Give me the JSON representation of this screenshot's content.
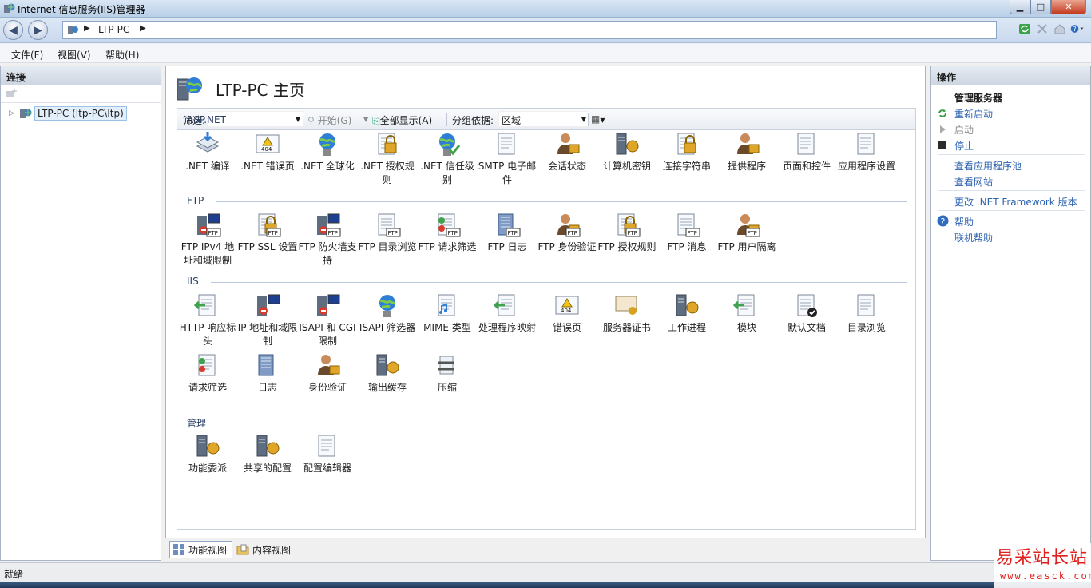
{
  "window": {
    "title": "Internet 信息服务(IIS)管理器"
  },
  "address": {
    "crumbs": [
      "LTP-PC"
    ]
  },
  "menu": {
    "items": [
      "文件(F)",
      "视图(V)",
      "帮助(H)"
    ]
  },
  "connections": {
    "title": "连接",
    "tree": [
      {
        "label": "LTP-PC (ltp-PC\\ltp)",
        "expanded": false,
        "selected": true
      }
    ]
  },
  "home": {
    "title": "LTP-PC 主页",
    "filter": {
      "label": "筛选:",
      "start": "开始(G)",
      "show_all": "全部显示(A)",
      "group_by_label": "分组依据:",
      "group_by_value": "区域"
    },
    "groups": [
      {
        "title": "ASP.NET",
        "features": [
          {
            "label": ".NET 编译",
            "icon": "net-compile-icon"
          },
          {
            "label": ".NET 错误页",
            "icon": "net-error-pages-icon"
          },
          {
            "label": ".NET 全球化",
            "icon": "net-globalization-icon"
          },
          {
            "label": ".NET 授权规则",
            "icon": "net-authorization-icon"
          },
          {
            "label": ".NET 信任级别",
            "icon": "net-trust-levels-icon"
          },
          {
            "label": "SMTP 电子邮件",
            "icon": "smtp-email-icon"
          },
          {
            "label": "会话状态",
            "icon": "session-state-icon"
          },
          {
            "label": "计算机密钥",
            "icon": "machine-key-icon"
          },
          {
            "label": "连接字符串",
            "icon": "connection-strings-icon"
          },
          {
            "label": "提供程序",
            "icon": "providers-icon"
          },
          {
            "label": "页面和控件",
            "icon": "pages-controls-icon"
          },
          {
            "label": "应用程序设置",
            "icon": "app-settings-icon"
          }
        ]
      },
      {
        "title": "FTP",
        "features": [
          {
            "label": "FTP IPv4 地址和域限制",
            "icon": "ftp-ip-restrictions-icon"
          },
          {
            "label": "FTP SSL 设置",
            "icon": "ftp-ssl-icon"
          },
          {
            "label": "FTP 防火墙支持",
            "icon": "ftp-firewall-icon"
          },
          {
            "label": "FTP 目录浏览",
            "icon": "ftp-directory-browsing-icon"
          },
          {
            "label": "FTP 请求筛选",
            "icon": "ftp-request-filtering-icon"
          },
          {
            "label": "FTP 日志",
            "icon": "ftp-logging-icon"
          },
          {
            "label": "FTP 身份验证",
            "icon": "ftp-authentication-icon"
          },
          {
            "label": "FTP 授权规则",
            "icon": "ftp-authorization-icon"
          },
          {
            "label": "FTP 消息",
            "icon": "ftp-messages-icon"
          },
          {
            "label": "FTP 用户隔离",
            "icon": "ftp-user-isolation-icon"
          }
        ]
      },
      {
        "title": "IIS",
        "features": [
          {
            "label": "HTTP 响应标头",
            "icon": "http-headers-icon"
          },
          {
            "label": "IP 地址和域限制",
            "icon": "ip-restrictions-icon"
          },
          {
            "label": "ISAPI 和 CGI 限制",
            "icon": "isapi-cgi-icon"
          },
          {
            "label": "ISAPI 筛选器",
            "icon": "isapi-filters-icon"
          },
          {
            "label": "MIME 类型",
            "icon": "mime-types-icon"
          },
          {
            "label": "处理程序映射",
            "icon": "handler-mappings-icon"
          },
          {
            "label": "错误页",
            "icon": "error-pages-icon"
          },
          {
            "label": "服务器证书",
            "icon": "server-certificates-icon"
          },
          {
            "label": "工作进程",
            "icon": "worker-processes-icon"
          },
          {
            "label": "模块",
            "icon": "modules-icon"
          },
          {
            "label": "默认文档",
            "icon": "default-document-icon"
          },
          {
            "label": "目录浏览",
            "icon": "directory-browsing-icon"
          },
          {
            "label": "请求筛选",
            "icon": "request-filtering-icon"
          },
          {
            "label": "日志",
            "icon": "logging-icon"
          },
          {
            "label": "身份验证",
            "icon": "authentication-icon"
          },
          {
            "label": "输出缓存",
            "icon": "output-caching-icon"
          },
          {
            "label": "压缩",
            "icon": "compression-icon"
          }
        ]
      },
      {
        "title": "管理",
        "features": [
          {
            "label": "功能委派",
            "icon": "feature-delegation-icon"
          },
          {
            "label": "共享的配置",
            "icon": "shared-configuration-icon"
          },
          {
            "label": "配置编辑器",
            "icon": "configuration-editor-icon"
          }
        ]
      }
    ]
  },
  "view_tabs": [
    {
      "label": "功能视图",
      "active": true
    },
    {
      "label": "内容视图",
      "active": false
    }
  ],
  "actions": {
    "title": "操作",
    "section_title": "管理服务器",
    "items": [
      "重新启动",
      "启动",
      "停止",
      "查看应用程序池",
      "查看网站",
      "更改 .NET Framework 版本",
      "帮助",
      "联机帮助"
    ]
  },
  "status": {
    "text": "就绪"
  },
  "watermark": {
    "main": "易采站长站",
    "sub": "www.easck.com"
  },
  "colors": {
    "link": "#2d63b0",
    "accent": "#3b82c4",
    "watermark": "#e0201c"
  }
}
